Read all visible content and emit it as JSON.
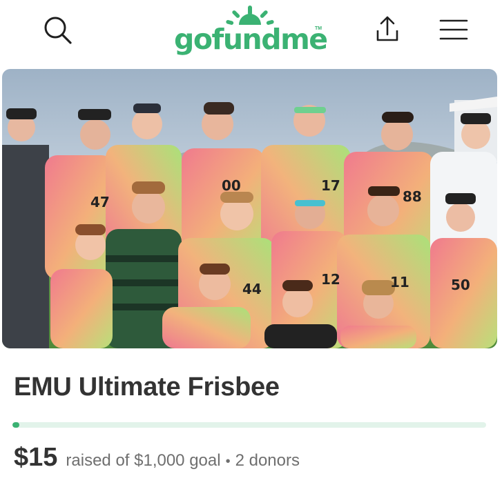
{
  "header": {
    "logo_text": "gofundme",
    "logo_tm": "TM",
    "icons": {
      "search": "search-icon",
      "share": "share-icon",
      "menu": "hamburger-menu-icon"
    }
  },
  "hero_image": {
    "alt": "EMU Ultimate Frisbee"
  },
  "campaign": {
    "title": "EMU Ultimate Frisbee",
    "progress_fraction": 0.015,
    "amount_raised": "$15",
    "raised_text": "raised of $1,000 goal",
    "separator": "•",
    "donors_text": "2 donors"
  },
  "colors": {
    "brand_green": "#3bb273",
    "progress_track": "#e2f3ea",
    "text_dark": "#333333",
    "text_muted": "#6f6f6f"
  }
}
